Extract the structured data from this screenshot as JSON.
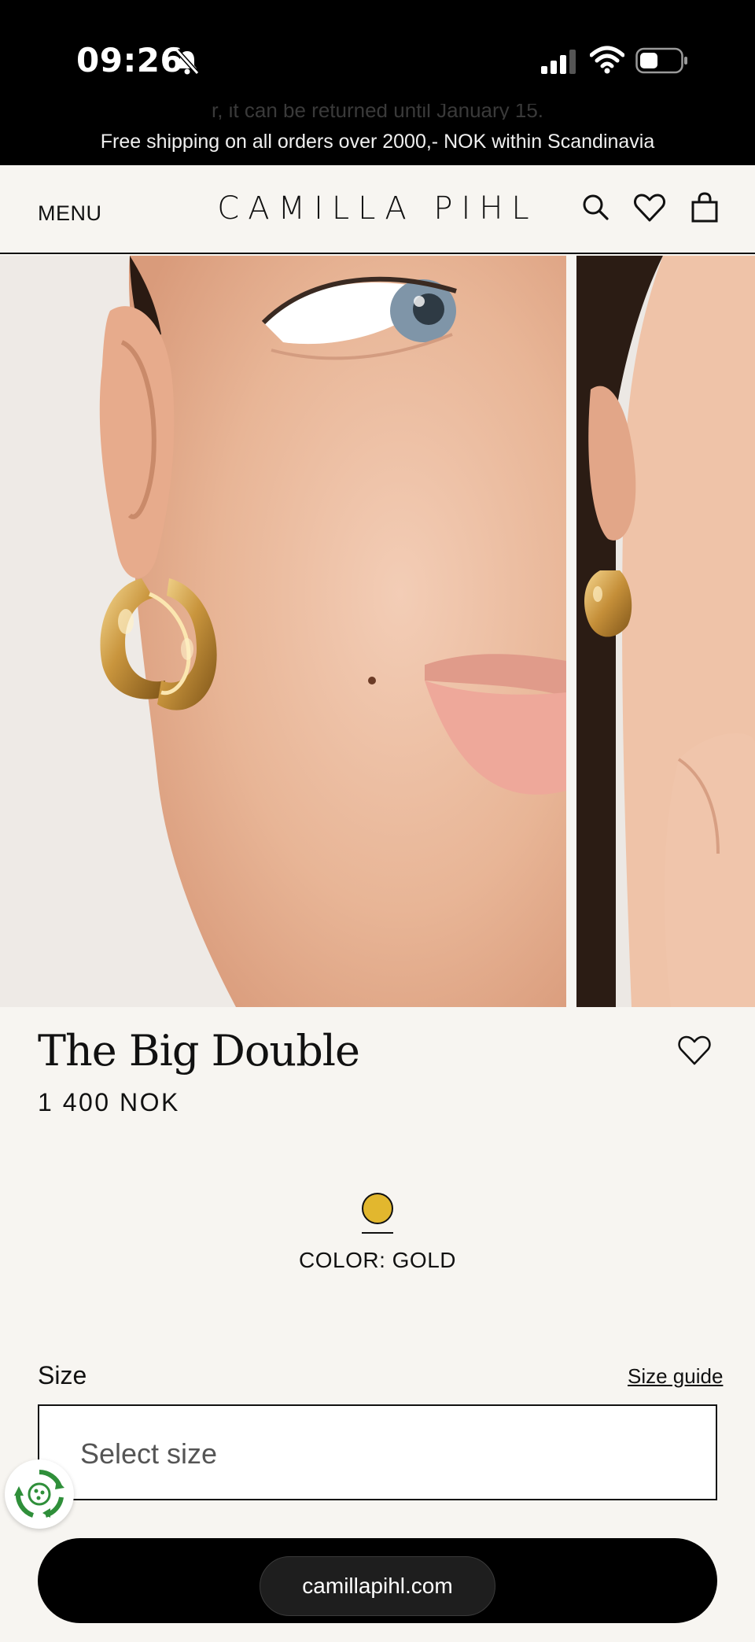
{
  "status_bar": {
    "time": "09:26",
    "icons": [
      "bell-slash-icon",
      "signal-icon",
      "wifi-icon",
      "battery-icon"
    ]
  },
  "announcement": {
    "faded_text": "r, it can be returned until January 15.",
    "text": "Free shipping on all orders over 2000,- NOK within Scandinavia"
  },
  "header": {
    "menu_label": "MENU",
    "logo": "CAMILLA PIHL",
    "icons": [
      "search-icon",
      "heart-icon",
      "bag-icon"
    ]
  },
  "product": {
    "title": "The Big Double",
    "price": "1 400 NOK",
    "color_label": "COLOR: GOLD",
    "swatch_color": "#e2b72e",
    "size_label": "Size",
    "size_guide_label": "Size guide",
    "size_select_value": "Select size"
  },
  "browser": {
    "url": "camillapihl.com"
  },
  "colors": {
    "background": "#f7f5f1",
    "status_bar": "#000000",
    "gold": "#e2b72e"
  }
}
